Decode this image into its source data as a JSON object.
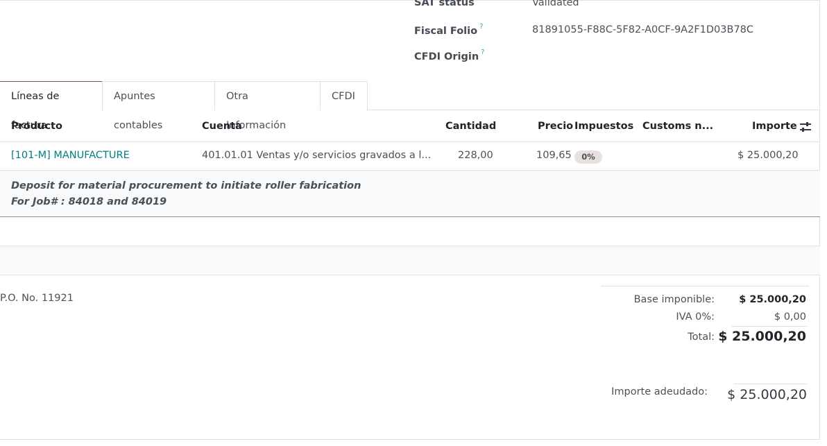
{
  "fields": {
    "sat_status_label": "SAT status",
    "sat_status_value": "Validated",
    "fiscal_folio_label": "Fiscal Folio",
    "fiscal_folio_value": "81891055-F88C-5F82-A0CF-9A2F1D03B78C",
    "cfdi_origin_label": "CFDI Origin",
    "help_mark": "?"
  },
  "tabs": [
    {
      "label": "Líneas de factura",
      "active": true
    },
    {
      "label": "Apuntes contables",
      "active": false
    },
    {
      "label": "Otra Información",
      "active": false
    },
    {
      "label": "CFDI",
      "active": false
    }
  ],
  "table": {
    "headers": {
      "product": "Producto",
      "account": "Cuenta",
      "quantity": "Cantidad",
      "price": "Precio",
      "taxes": "Impuestos",
      "customs": "Customs n...",
      "amount": "Importe"
    },
    "row": {
      "product": "[101-M] MANUFACTURE",
      "account": "401.01.01 Ventas y/o servicios gravados a l...",
      "quantity": "228,00",
      "price": "109,65",
      "tax_badge": "0%",
      "customs": "",
      "amount": "$ 25.000,20"
    },
    "note": {
      "line1": "Deposit for material procurement to initiate roller fabrication",
      "line2": "For Job# : 84018 and 84019"
    }
  },
  "footer": {
    "po_text": "P.O. No. 11921",
    "base_label": "Base imponible:",
    "base_value": "$ 25.000,20",
    "iva_label": "IVA 0%:",
    "iva_value": "$ 0,00",
    "total_label": "Total:",
    "total_value": "$ 25.000,20",
    "due_label": "Importe adeudado:",
    "due_value": "$ 25.000,20"
  },
  "colors": {
    "link": "#017e84",
    "tab_accent": "#7c4a65",
    "help": "#36a3c4"
  }
}
